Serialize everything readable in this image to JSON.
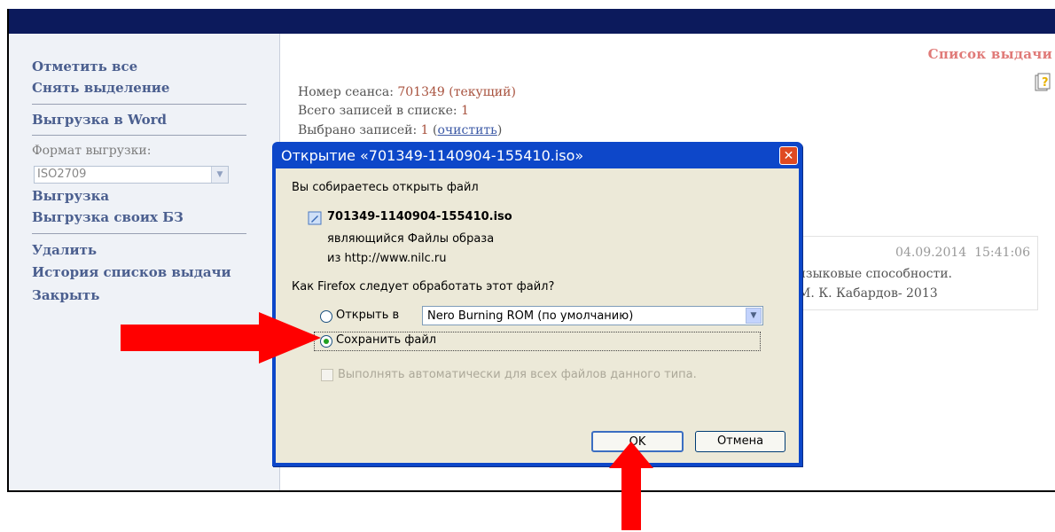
{
  "sidebar": {
    "select_all": "Отметить все",
    "deselect": "Снять выделение",
    "export_word": "Выгрузка в Word",
    "format_label": "Формат выгрузки:",
    "format_value": "ISO2709",
    "export": "Выгрузка",
    "export_own": "Выгрузка своих БЗ",
    "delete": "Удалить",
    "history": "История списков выдачи",
    "close": "Закрыть"
  },
  "main": {
    "list_title": "Список выдачи",
    "session_label": "Номер сеанса:",
    "session_value": "701349 (текущий)",
    "total_label": "Всего записей в списке:",
    "total_value": "1",
    "selected_label": "Выбрано записей:",
    "selected_value": "1",
    "clear_open": "(",
    "clear_link": "очистить",
    "clear_close": ")",
    "record_date": "04.09.2014",
    "record_time": "15:41:06",
    "record_line1": "языковые способности.",
    "record_line2": "М. К. Кабардов- 2013"
  },
  "dialog": {
    "title": "Открытие «701349-1140904-155410.iso»",
    "intro": "Вы собираетесь открыть файл",
    "filename": "701349-1140904-155410.iso",
    "filetype": "являющийся  Файлы образа",
    "source": "из http://www.nilc.ru",
    "question": "Как Firefox следует обработать этот файл?",
    "open_with_label": "Открыть в",
    "open_with_app": "Nero Burning ROM (по умолчанию)",
    "save_label": "Сохранить файл",
    "auto_label": "Выполнять автоматически для всех файлов данного типа.",
    "ok": "OK",
    "cancel": "Отмена"
  },
  "colors": {
    "titlebar": "#0d47c9",
    "arrow": "#ff0000",
    "header": "#0c1a5c"
  }
}
